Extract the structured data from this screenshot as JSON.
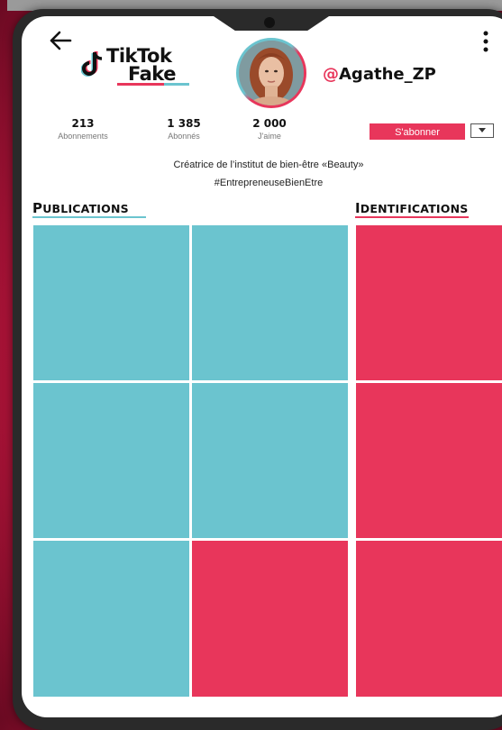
{
  "header": {
    "logo_line1": "TikTok",
    "logo_line2": "Fake",
    "username_at": "@",
    "username_name": "Agathe_ZP"
  },
  "stats": [
    {
      "value": "213",
      "label": "Abonnements"
    },
    {
      "value": "1 385",
      "label": "Abonnés"
    },
    {
      "value": "2 000",
      "label": "J'aime"
    }
  ],
  "subscribe": {
    "label": "S'abonner"
  },
  "bio": {
    "line1": "Créatrice de l’institut de bien-être «Beauty»",
    "line2": "#EntrepreneuseBienEtre"
  },
  "sections": {
    "publications_first": "P",
    "publications_rest": "UBLICATIONS",
    "identifications_first": "I",
    "identifications_rest": "DENTIFICATIONS"
  },
  "colors": {
    "teal": "#6bc4cf",
    "red": "#e8365b"
  },
  "icons": [
    "back-arrow-icon",
    "tiktok-note-icon",
    "more-vertical-icon",
    "chevron-down-icon"
  ]
}
